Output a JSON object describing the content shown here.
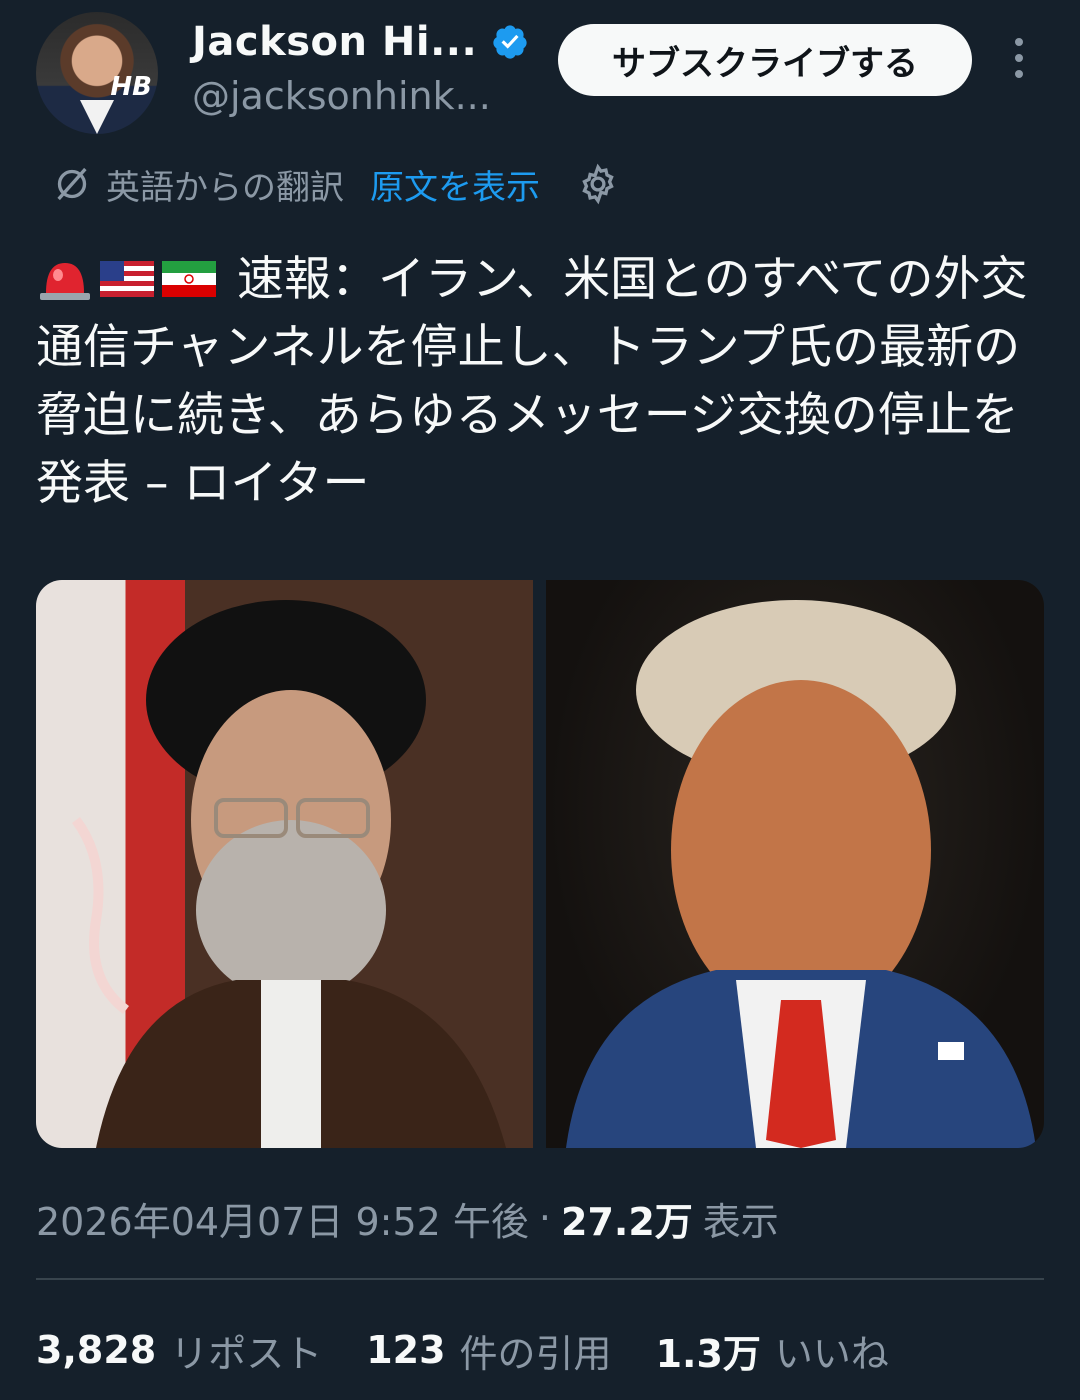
{
  "author": {
    "name": "Jackson Hi...",
    "handle": "@jacksonhink..."
  },
  "header": {
    "subscribe_label": "サブスクライブする"
  },
  "translation": {
    "label": "英語からの翻訳",
    "show_original": "原文を表示"
  },
  "tweet": {
    "text": "速報：イラン、米国とのすべての外交通信チャンネルを停止し、トランプ氏の最新の脅迫に続き、あらゆるメッセージ交換の停止を発表 – ロイター"
  },
  "meta": {
    "datetime": "2026年04月07日 9:52 午後",
    "separator": "·",
    "views_count": "27.2万",
    "views_label": "表示"
  },
  "stats": [
    {
      "value": "3,828",
      "label": "リポスト"
    },
    {
      "value": "123",
      "label": "件の引用"
    },
    {
      "value": "1.3万",
      "label": "いいね"
    }
  ],
  "colors": {
    "background": "#15202b",
    "accent": "#1d9bf0",
    "muted": "#8b98a5"
  },
  "icons": [
    "verified-badge-icon",
    "more-icon",
    "translate-icon",
    "gear-icon",
    "siren-emoji",
    "us-flag-emoji",
    "iran-flag-emoji"
  ]
}
